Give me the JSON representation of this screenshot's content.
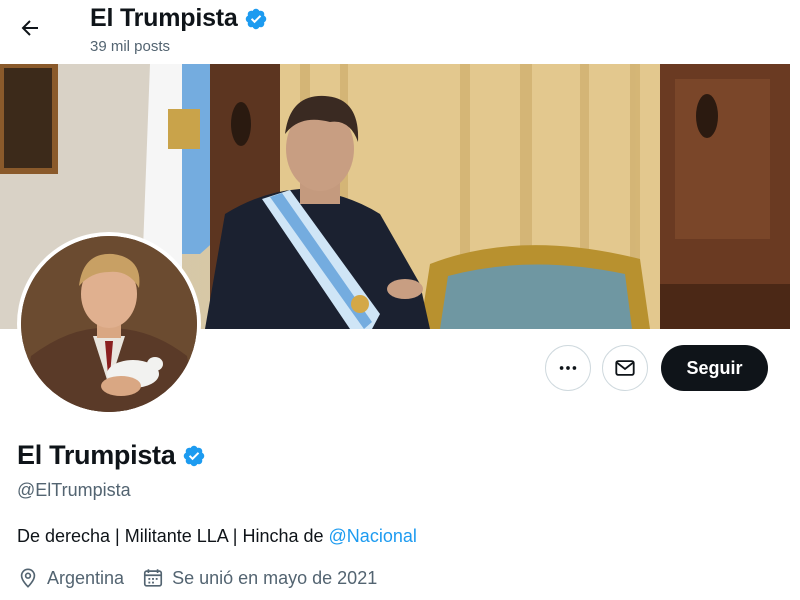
{
  "header": {
    "title": "El Trumpista",
    "posts_count": "39 mil posts"
  },
  "icons": {
    "back": "arrow-left-icon",
    "verified": "verified-badge-icon",
    "more": "more-dots-icon",
    "message": "envelope-icon",
    "location": "location-pin-icon",
    "calendar": "calendar-icon"
  },
  "actions": {
    "follow_label": "Seguir"
  },
  "profile": {
    "name": "El Trumpista",
    "handle": "@ElTrumpista",
    "bio_text": "De derecha | Militante LLA | Hincha de ",
    "bio_mention": "@Nacional",
    "location": "Argentina",
    "joined": "Se unió en mayo de 2021"
  },
  "colors": {
    "accent": "#1d9bf0",
    "text_primary": "#0f1419",
    "text_secondary": "#536471",
    "follow_bg": "#0f1419"
  }
}
